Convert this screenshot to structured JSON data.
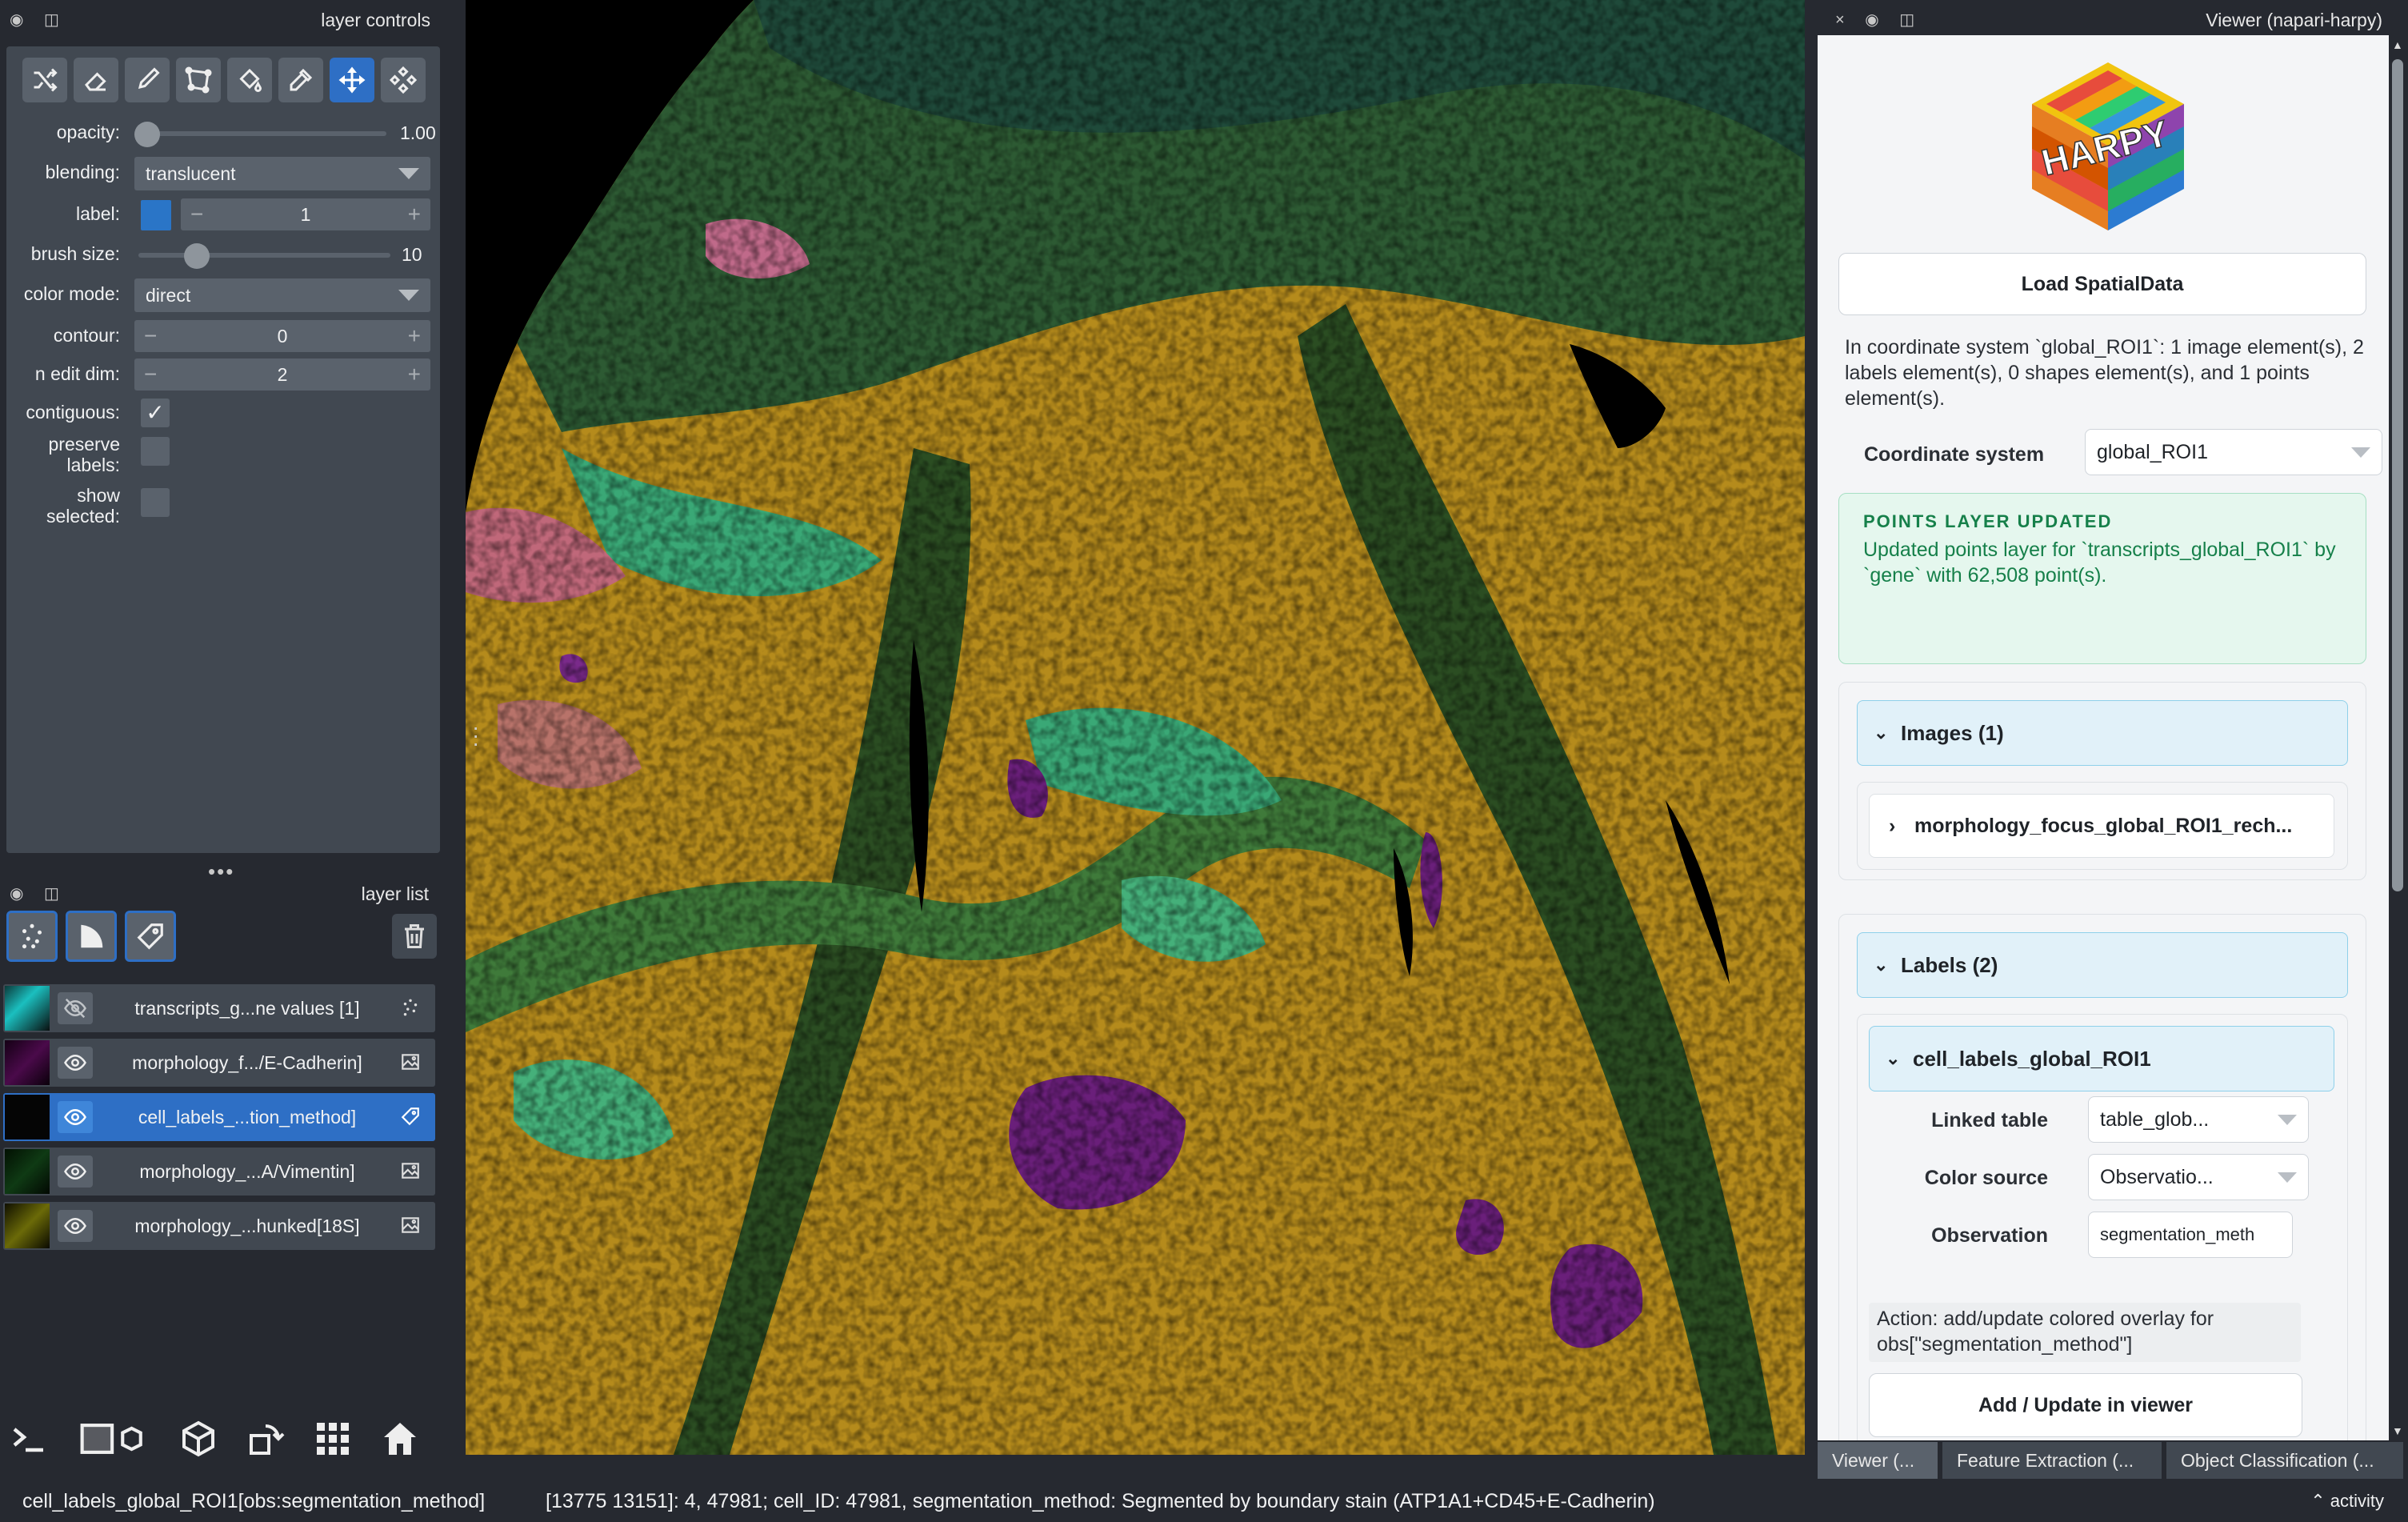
{
  "left": {
    "controls_title": "layer controls",
    "controls": {
      "opacity_label": "opacity:",
      "opacity_value": "1.00",
      "opacity": 0.0,
      "blending_label": "blending:",
      "blending_value": "translucent",
      "label_label": "label:",
      "label_value": "1",
      "brush_size_label": "brush size:",
      "brush_size_value": "10",
      "color_mode_label": "color mode:",
      "color_mode_value": "direct",
      "contour_label": "contour:",
      "contour_value": "0",
      "n_edit_dim_label": "n edit dim:",
      "n_edit_dim_value": "2",
      "contiguous_label": "contiguous:",
      "preserve_labels_label_1": "preserve",
      "preserve_labels_label_2": "labels:",
      "show_selected_label_1": "show",
      "show_selected_label_2": "selected:",
      "check_mark": "✓",
      "minus": "−",
      "plus": "+",
      "label_color": "#2a75c7"
    },
    "list_title": "layer list",
    "splitter": "•••",
    "layers": [
      {
        "name": "transcripts_g...ne values [1]",
        "type_icon": "points-icon",
        "visible": false
      },
      {
        "name": "morphology_f.../E-Cadherin]",
        "type_icon": "image-icon",
        "visible": true
      },
      {
        "name": "cell_labels_...tion_method]",
        "type_icon": "labels-icon",
        "visible": true,
        "selected": true
      },
      {
        "name": "morphology_...A/Vimentin]",
        "type_icon": "image-icon",
        "visible": true
      },
      {
        "name": "morphology_...hunked[18S]",
        "type_icon": "image-icon",
        "visible": true
      }
    ]
  },
  "right": {
    "title": "Viewer (napari-harpy)",
    "title_icons": "× ◉ ◫",
    "logo_text": "HARPY",
    "load_button": "Load SpatialData",
    "info": "In coordinate system `global_ROI1`: 1 image element(s), 2 labels element(s), 0 shapes element(s), and 1 points element(s).",
    "coord_label": "Coordinate system",
    "coord_value": "global_ROI1",
    "notice_head": "POINTS LAYER UPDATED",
    "notice_body": "Updated points layer for `transcripts_global_ROI1` by `gene` with 62,508 point(s).",
    "images_header": "Images (1)",
    "images_item": "morphology_focus_global_ROI1_rech...",
    "labels_header": "Labels (2)",
    "labels_item": "cell_labels_global_ROI1",
    "chevron_down": "⌄",
    "chevron_right": "›",
    "linked_table_label": "Linked table",
    "linked_table_value": "table_glob...",
    "color_source_label": "Color source",
    "color_source_value": "Observatio...",
    "observation_label": "Observation",
    "observation_value": "segmentation_meth",
    "action_text": "Action: add/update colored overlay for obs[\"segmentation_method\"]",
    "add_button": "Add / Update in viewer",
    "tabs": [
      "Viewer (...",
      "Feature Extraction (...",
      "Object Classification (..."
    ]
  },
  "status": {
    "layer": "cell_labels_global_ROI1[obs:segmentation_method]",
    "info": "[13775 13151]: 4, 47981; cell_ID: 47981, segmentation_method: Segmented by boundary stain (ATP1A1+CD45+E-Cadherin)",
    "activity": "activity",
    "activity_glyph": "⌃"
  },
  "colors": {
    "accent": "#2e6fc5",
    "panel": "#414851",
    "background": "#262930",
    "notice_green": "#16804a"
  }
}
